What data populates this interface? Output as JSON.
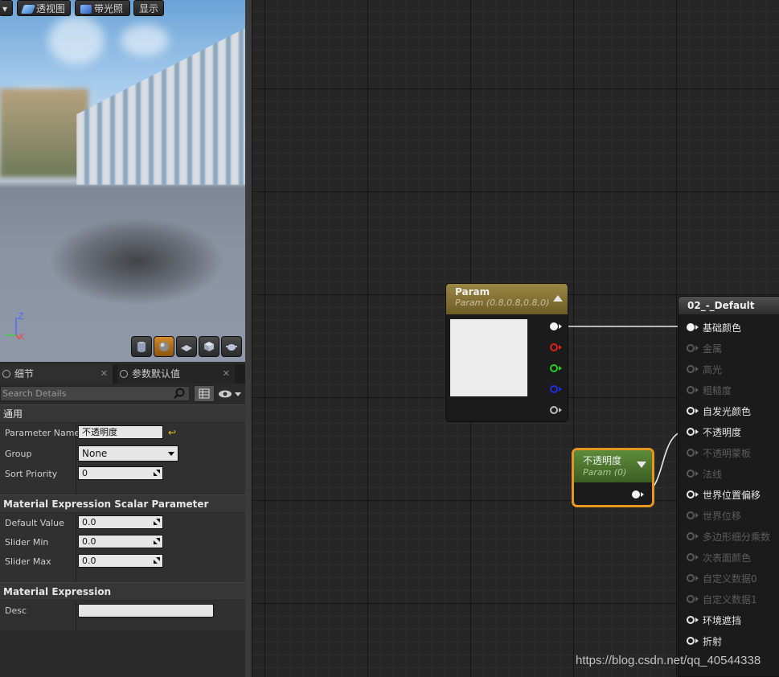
{
  "viewport": {
    "buttons": [
      {
        "label": "▾"
      },
      {
        "label": "透视图"
      },
      {
        "label": "带光照"
      },
      {
        "label": "显示"
      }
    ],
    "axes": {
      "z": "Z",
      "x": "X"
    }
  },
  "tabs": [
    {
      "label": "细节"
    },
    {
      "label": "参数默认值"
    }
  ],
  "search": {
    "placeholder": "Search Details"
  },
  "details": {
    "general": {
      "title": "通用",
      "parameter_name_label": "Parameter Name",
      "parameter_name_value": "不透明度",
      "group_label": "Group",
      "group_value": "None",
      "sort_priority_label": "Sort Priority",
      "sort_priority_value": "0"
    },
    "scalar": {
      "title": "Material Expression Scalar Parameter",
      "default_value_label": "Default Value",
      "default_value": "0.0",
      "slider_min_label": "Slider Min",
      "slider_min": "0.0",
      "slider_max_label": "Slider Max",
      "slider_max": "0.0"
    },
    "expression": {
      "title": "Material Expression",
      "desc_label": "Desc",
      "desc_value": ""
    }
  },
  "graph": {
    "vector_node": {
      "title": "Param",
      "subtitle": "Param (0.8,0.8,0.8,0)"
    },
    "scalar_node": {
      "title": "不透明度",
      "subtitle": "Param (0)"
    },
    "material_node": {
      "title": "02_-_Default",
      "inputs": [
        {
          "label": "基础颜色",
          "active": true
        },
        {
          "label": "金属",
          "active": false
        },
        {
          "label": "高光",
          "active": false
        },
        {
          "label": "粗糙度",
          "active": false
        },
        {
          "label": "自发光颜色",
          "active": true
        },
        {
          "label": "不透明度",
          "active": true
        },
        {
          "label": "不透明蒙板",
          "active": false
        },
        {
          "label": "法线",
          "active": false
        },
        {
          "label": "世界位置偏移",
          "active": true
        },
        {
          "label": "世界位移",
          "active": false
        },
        {
          "label": "多边形细分乘数",
          "active": false
        },
        {
          "label": "次表面颜色",
          "active": false
        },
        {
          "label": "自定义数据0",
          "active": false
        },
        {
          "label": "自定义数据1",
          "active": false
        },
        {
          "label": "环境遮挡",
          "active": true
        },
        {
          "label": "折射",
          "active": true
        }
      ]
    }
  },
  "watermark": "https://blog.csdn.net/qq_40544338",
  "colors": {
    "accent": "#f0a020",
    "vector_header": "#8c7a3a",
    "scalar_header": "#4f7a2f"
  }
}
